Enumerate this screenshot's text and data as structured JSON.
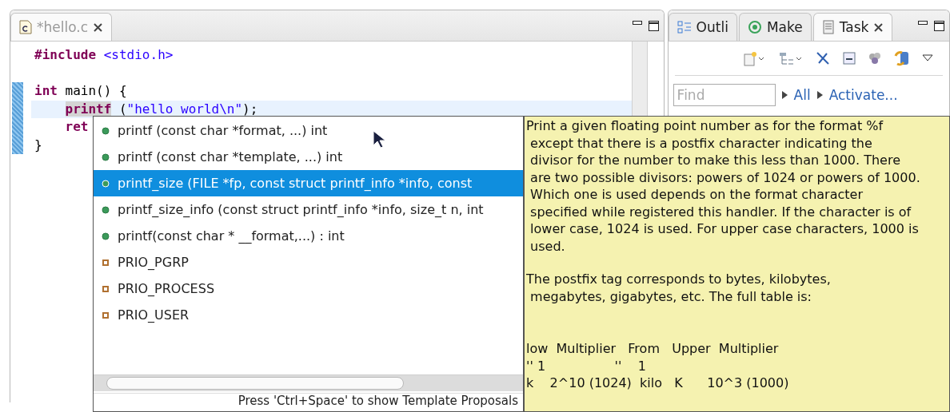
{
  "editor": {
    "tab": {
      "title": "*hello.c",
      "selected": true
    },
    "lines": [
      {
        "current": false,
        "changed": false,
        "tokens": [
          {
            "text": "#include",
            "kind": "keyword"
          },
          {
            "text": " <stdio.h>",
            "kind": "string"
          }
        ]
      },
      {
        "current": false,
        "changed": false
      },
      {
        "current": false,
        "changed": true,
        "tokens": [
          {
            "text": "int",
            "kind": "keyword"
          },
          {
            "text": " main() {",
            "kind": "plain"
          }
        ]
      },
      {
        "current": true,
        "changed": true,
        "indent": true,
        "tokens": [
          {
            "text": "printf",
            "kind": "occurrence"
          },
          {
            "text": " (",
            "kind": "plain"
          },
          {
            "text": "\"hello world\\n\"",
            "kind": "string"
          },
          {
            "text": ");",
            "kind": "plain"
          }
        ]
      },
      {
        "current": false,
        "changed": true,
        "indent": true,
        "tokens": [
          {
            "text": "ret",
            "kind": "keyword"
          }
        ]
      },
      {
        "current": false,
        "changed": true,
        "tokens": [
          {
            "text": "}",
            "kind": "plain"
          }
        ]
      }
    ]
  },
  "side_panel": {
    "tabs": [
      {
        "label": "Outli",
        "selected": false,
        "kind": "outline"
      },
      {
        "label": "Make",
        "selected": false,
        "kind": "make"
      },
      {
        "label": "Task",
        "selected": true,
        "kind": "task"
      }
    ],
    "find": {
      "placeholder": "Find"
    },
    "links": [
      "All",
      "Activate..."
    ]
  },
  "completion": {
    "items": [
      {
        "label": "printf (const char *format, ...) int",
        "kind": "function",
        "selected": false
      },
      {
        "label": "printf (const char *template, ...) int",
        "kind": "function",
        "selected": false
      },
      {
        "label": "printf_size (FILE *fp, const struct printf_info *info, const",
        "kind": "function",
        "selected": true
      },
      {
        "label": "printf_size_info (const struct printf_info *info, size_t n, int",
        "kind": "function",
        "selected": false
      },
      {
        "label": "printf(const char * __format,...) : int",
        "kind": "function",
        "selected": false
      },
      {
        "label": "PRIO_PGRP",
        "kind": "constant",
        "selected": false
      },
      {
        "label": "PRIO_PROCESS",
        "kind": "constant",
        "selected": false
      },
      {
        "label": "PRIO_USER",
        "kind": "constant",
        "selected": false
      }
    ],
    "status": "Press 'Ctrl+Space' to show Template Proposals"
  },
  "documentation": {
    "blocks": [
      {
        "kind": "paragraph",
        "lines": [
          "Print a given floating point number as for the format %f",
          " except that there is a postfix character indicating the",
          " divisor for the number to make this less than 1000. There",
          " are two possible divisors: powers of 1024 or powers of 1000.",
          " Which one is used depends on the format character",
          " specified while registered this handler. If the character is of",
          " lower case, 1024 is used. For upper case characters, 1000 is",
          " used."
        ]
      },
      {
        "kind": "paragraph",
        "lines": [
          "The postfix tag corresponds to bytes, kilobytes,",
          " megabytes, gigabytes, etc. The full table is:"
        ]
      },
      {
        "kind": "table",
        "lines": [
          "low  Multiplier   From   Upper  Multiplier",
          "'' 1                 ''    1",
          "k    2^10 (1024)  kilo   K      10^3 (1000)"
        ]
      }
    ]
  }
}
